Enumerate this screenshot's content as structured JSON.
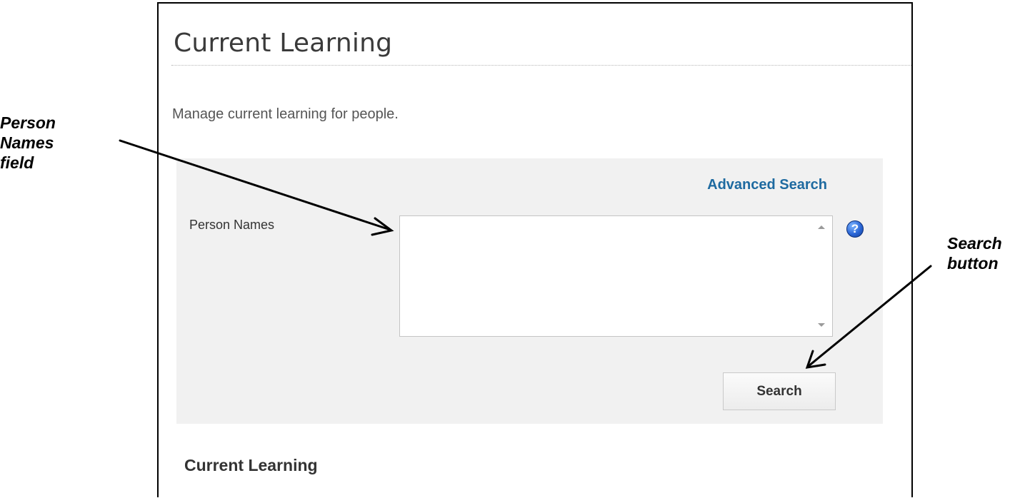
{
  "annotations": {
    "person_names_field": [
      "Person",
      "Names",
      "field"
    ],
    "search_button": [
      "Search",
      "button"
    ]
  },
  "page": {
    "title": "Current Learning",
    "description": "Manage current learning for people."
  },
  "search_panel": {
    "advanced_search_label": "Advanced Search",
    "person_names_label": "Person Names",
    "person_names_value": "",
    "help_icon": "question-mark-icon",
    "help_glyph": "?",
    "search_button_label": "Search"
  },
  "section": {
    "heading": "Current Learning"
  },
  "colors": {
    "link": "#1e6aa0",
    "panel_background": "#f1f1f1",
    "help_icon": "#2a66d6"
  }
}
